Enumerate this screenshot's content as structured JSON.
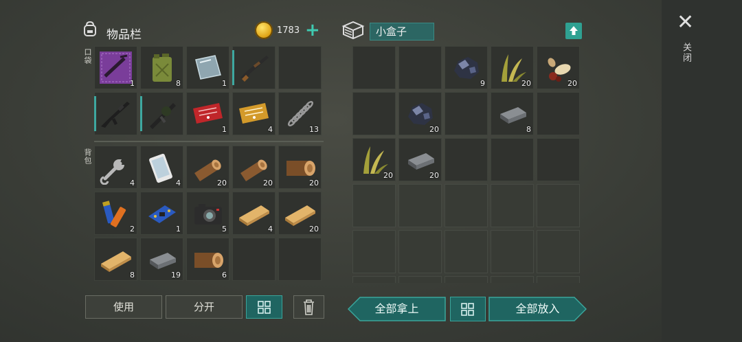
{
  "inventory": {
    "title": "物品栏",
    "coins": "1783",
    "pocket_label": "口袋",
    "backpack_label": "背包",
    "pocket_slots": [
      {
        "item": "rifle-blueprint-icon",
        "count": "1",
        "bar": false
      },
      {
        "item": "fuel-canister-icon",
        "count": "8",
        "bar": false
      },
      {
        "item": "glass-plate-icon",
        "count": "1",
        "bar": false
      },
      {
        "item": "shotgun-icon",
        "count": "",
        "bar": true
      },
      {
        "item": "",
        "count": "",
        "bar": false
      },
      {
        "item": "assault-rifle-icon",
        "count": "",
        "bar": true
      },
      {
        "item": "grenade-launcher-icon",
        "count": "",
        "bar": true
      },
      {
        "item": "red-coupon-icon",
        "count": "1",
        "bar": false
      },
      {
        "item": "gold-coupon-icon",
        "count": "4",
        "bar": false
      },
      {
        "item": "spring-icon",
        "count": "13",
        "bar": false
      }
    ],
    "backpack_slots": [
      {
        "item": "wrench-icon",
        "count": "4"
      },
      {
        "item": "smartphone-icon",
        "count": "4"
      },
      {
        "item": "log-icon",
        "count": "20"
      },
      {
        "item": "log-icon",
        "count": "20"
      },
      {
        "item": "log-end-icon",
        "count": "20"
      },
      {
        "item": "batteries-icon",
        "count": "2"
      },
      {
        "item": "circuit-board-icon",
        "count": "1"
      },
      {
        "item": "camera-icon",
        "count": "5"
      },
      {
        "item": "plank-icon",
        "count": "4"
      },
      {
        "item": "plank-icon",
        "count": "20"
      },
      {
        "item": "plank-icon",
        "count": "8"
      },
      {
        "item": "iron-ingot-icon",
        "count": "19"
      },
      {
        "item": "log-end-icon",
        "count": "6"
      },
      {
        "item": "",
        "count": ""
      },
      {
        "item": "",
        "count": ""
      }
    ],
    "buttons": {
      "use": "使用",
      "split": "分开"
    }
  },
  "container": {
    "name": "小盒子",
    "slots": [
      {
        "item": "",
        "count": ""
      },
      {
        "item": "",
        "count": ""
      },
      {
        "item": "ore-icon",
        "count": "9"
      },
      {
        "item": "plant-fiber-icon",
        "count": "20"
      },
      {
        "item": "seeds-icon",
        "count": "20"
      },
      {
        "item": "",
        "count": ""
      },
      {
        "item": "ore-icon",
        "count": "20"
      },
      {
        "item": "",
        "count": ""
      },
      {
        "item": "iron-ingot-icon",
        "count": "8"
      },
      {
        "item": "",
        "count": ""
      },
      {
        "item": "plant-fiber-icon",
        "count": "20"
      },
      {
        "item": "iron-ingot-icon",
        "count": "20"
      },
      {
        "item": "",
        "count": ""
      },
      {
        "item": "",
        "count": ""
      },
      {
        "item": "",
        "count": ""
      }
    ],
    "buttons": {
      "take_all": "全部拿上",
      "put_all": "全部放入"
    }
  },
  "side": {
    "close_label": "关闭"
  },
  "colors": {
    "accent": "#3ea8a0",
    "teal_button": "#1f6561",
    "slot_bg": "#30322e"
  }
}
